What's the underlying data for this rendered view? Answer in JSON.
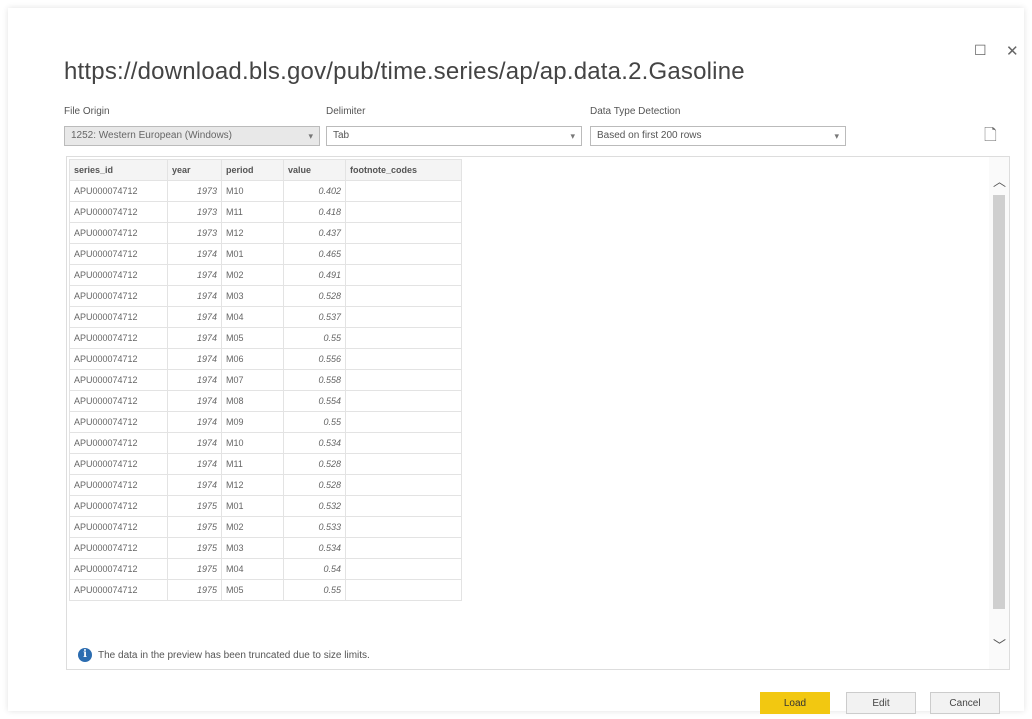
{
  "window": {
    "maximize_icon": "maximize-icon",
    "close_icon": "close-icon"
  },
  "title": "https://download.bls.gov/pub/time.series/ap/ap.data.2.Gasoline",
  "file_origin": {
    "label": "File Origin",
    "value": "1252: Western European (Windows)"
  },
  "delimiter": {
    "label": "Delimiter",
    "value": "Tab"
  },
  "data_type": {
    "label": "Data Type Detection",
    "value": "Based on first 200 rows"
  },
  "table": {
    "headers": [
      "series_id",
      "year",
      "period",
      "value",
      "footnote_codes"
    ],
    "rows": [
      [
        "APU000074712",
        "1973",
        "M10",
        "0.402",
        ""
      ],
      [
        "APU000074712",
        "1973",
        "M11",
        "0.418",
        ""
      ],
      [
        "APU000074712",
        "1973",
        "M12",
        "0.437",
        ""
      ],
      [
        "APU000074712",
        "1974",
        "M01",
        "0.465",
        ""
      ],
      [
        "APU000074712",
        "1974",
        "M02",
        "0.491",
        ""
      ],
      [
        "APU000074712",
        "1974",
        "M03",
        "0.528",
        ""
      ],
      [
        "APU000074712",
        "1974",
        "M04",
        "0.537",
        ""
      ],
      [
        "APU000074712",
        "1974",
        "M05",
        "0.55",
        ""
      ],
      [
        "APU000074712",
        "1974",
        "M06",
        "0.556",
        ""
      ],
      [
        "APU000074712",
        "1974",
        "M07",
        "0.558",
        ""
      ],
      [
        "APU000074712",
        "1974",
        "M08",
        "0.554",
        ""
      ],
      [
        "APU000074712",
        "1974",
        "M09",
        "0.55",
        ""
      ],
      [
        "APU000074712",
        "1974",
        "M10",
        "0.534",
        ""
      ],
      [
        "APU000074712",
        "1974",
        "M11",
        "0.528",
        ""
      ],
      [
        "APU000074712",
        "1974",
        "M12",
        "0.528",
        ""
      ],
      [
        "APU000074712",
        "1975",
        "M01",
        "0.532",
        ""
      ],
      [
        "APU000074712",
        "1975",
        "M02",
        "0.533",
        ""
      ],
      [
        "APU000074712",
        "1975",
        "M03",
        "0.534",
        ""
      ],
      [
        "APU000074712",
        "1975",
        "M04",
        "0.54",
        ""
      ],
      [
        "APU000074712",
        "1975",
        "M05",
        "0.55",
        ""
      ]
    ]
  },
  "info_text": "The data in the preview has been truncated due to size limits.",
  "buttons": {
    "load": "Load",
    "edit": "Edit",
    "cancel": "Cancel"
  },
  "colors": {
    "primary": "#f2c811",
    "info": "#2b6cb0"
  }
}
